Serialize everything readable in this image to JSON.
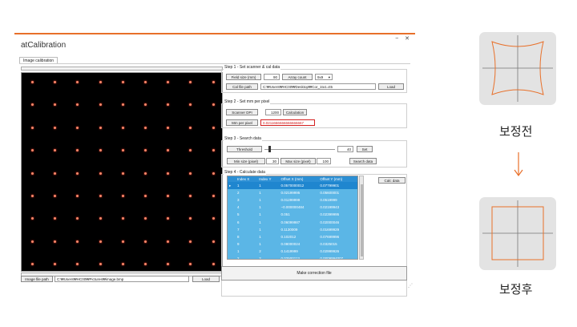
{
  "window": {
    "title": "atCalibration",
    "controls": "− ✕",
    "tab": "Image calibration",
    "resize_grip": "⋰"
  },
  "image_panel": {
    "image_file_path_button": "Image file path",
    "image_file_path_value": "C:₩Users₩HC00₩Pictures₩image.bmp",
    "load_button": "Load",
    "dot_color": "#ff8a6a"
  },
  "step1": {
    "title": "Step 1 - Set scanner & cal data",
    "field_size_button": "Field size (mm)",
    "field_size_value": "90",
    "array_count_button": "Array count",
    "array_count_value": "9x9",
    "cal_file_path_button": "Cal file path",
    "cal_file_path_value": "C:₩Users₩HC00₩Desktop₩Cor_1to1.ct5",
    "load_button": "Load"
  },
  "step2": {
    "title": "Step 2 - Set mm per pixel",
    "scanner_dpi_button": "Scanner DPI",
    "scanner_dpi_value": "1200",
    "calculation_button": "Calculation",
    "mm_per_pixel_button": "Mm per pixel",
    "mm_per_pixel_value": "0.0211666666666666667"
  },
  "step3": {
    "title": "Step 3 - Search data",
    "threshold_button": "Threshold",
    "threshold_value": "40",
    "threshold_level": 0.07,
    "set_button": "Set",
    "min_size_button": "Min size (pixel)",
    "min_size_value": "30",
    "max_size_button": "Max size (pixel)",
    "max_size_value": "100",
    "search_data_button": "Search data"
  },
  "step4": {
    "title": "Step 4 - Calculate data",
    "calc_data_button": "Calc data",
    "row_marker": "▸",
    "columns": [
      "Index X",
      "Index Y",
      "Offset X (mm)",
      "Offset Y (mm)"
    ],
    "rows": [
      [
        "1",
        "1",
        "0.0570000012",
        "0.07799901"
      ],
      [
        "2",
        "1",
        "0.02199995",
        "0.05600001"
      ],
      [
        "3",
        "1",
        "0.01299999",
        "0.0519999"
      ],
      [
        "4",
        "1",
        "−0.000000484",
        "0.02199943"
      ],
      [
        "5",
        "1",
        "0.051",
        "0.02399995"
      ],
      [
        "6",
        "1",
        "0.06099987",
        "0.02000046"
      ],
      [
        "7",
        "1",
        "0.1130009",
        "0.01699929"
      ],
      [
        "8",
        "1",
        "0.102012",
        "0.07699996"
      ],
      [
        "9",
        "1",
        "0.08000024",
        "0.0325015"
      ],
      [
        "1",
        "2",
        "0.1419999",
        "0.02999926"
      ],
      [
        "2",
        "2",
        "0.02500113",
        "0.0009994007"
      ]
    ],
    "selected_row": 0
  },
  "make_correction_button": "Make correction file",
  "side": {
    "before_label": "보정전",
    "after_label": "보정후",
    "arrow_color": "#e8702a",
    "accent": "#e8702a"
  }
}
